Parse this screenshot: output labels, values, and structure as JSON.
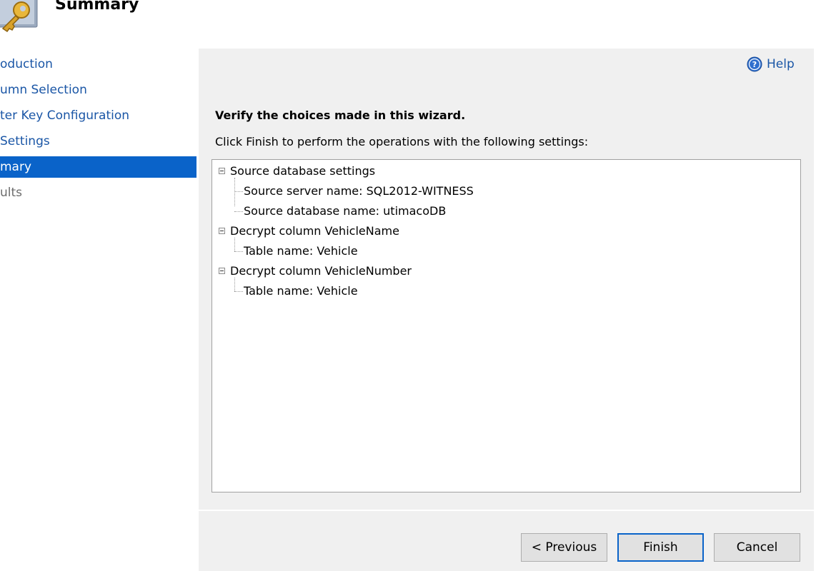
{
  "header": {
    "title": "Summary",
    "icon": "key-icon"
  },
  "nav": {
    "items": [
      {
        "label": "oduction",
        "state": "normal"
      },
      {
        "label": "umn Selection",
        "state": "normal"
      },
      {
        "label": "ter Key Configuration",
        "state": "normal"
      },
      {
        "label": " Settings",
        "state": "normal"
      },
      {
        "label": "mary",
        "state": "selected"
      },
      {
        "label": "ults",
        "state": "disabled"
      }
    ]
  },
  "help": {
    "label": "Help",
    "icon": "help-icon"
  },
  "main": {
    "heading": "Verify the choices made in this wizard.",
    "instruction": "Click Finish to perform the operations with the following settings:"
  },
  "tree": {
    "nodes": [
      {
        "label": "Source database settings",
        "expanded": true,
        "children": [
          {
            "label": "Source server name: SQL2012-WITNESS"
          },
          {
            "label": "Source database name: utimacoDB"
          }
        ]
      },
      {
        "label": "Decrypt column VehicleName",
        "expanded": true,
        "children": [
          {
            "label": "Table name: Vehicle"
          }
        ]
      },
      {
        "label": "Decrypt column VehicleNumber",
        "expanded": true,
        "children": [
          {
            "label": "Table name: Vehicle"
          }
        ]
      }
    ]
  },
  "buttons": {
    "previous": "< Previous",
    "finish": "Finish",
    "cancel": "Cancel"
  },
  "colors": {
    "link": "#1a56a6",
    "selection": "#0a63c9",
    "panel": "#f0f0f0"
  }
}
